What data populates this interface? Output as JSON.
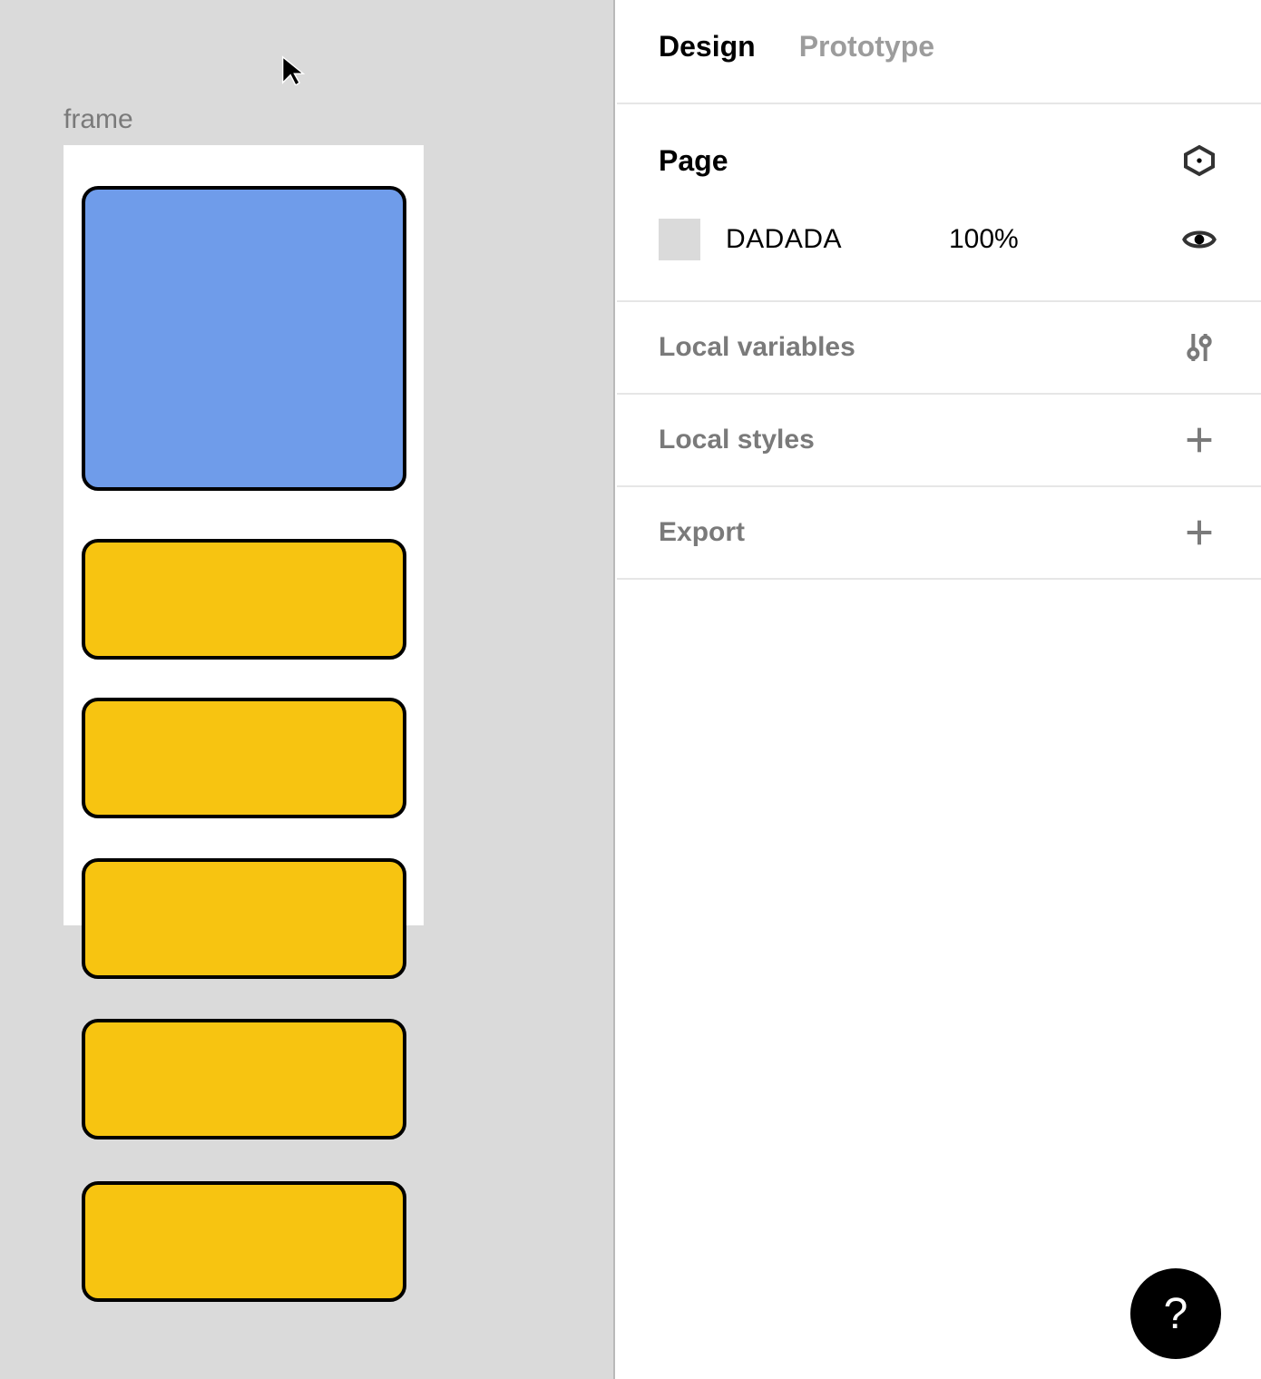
{
  "canvas": {
    "frame_label": "frame",
    "shapes": [
      {
        "kind": "large-blue"
      },
      {
        "kind": "yellow-bar"
      },
      {
        "kind": "yellow-bar"
      },
      {
        "kind": "yellow-bar"
      },
      {
        "kind": "yellow-bar"
      },
      {
        "kind": "yellow-bar"
      }
    ]
  },
  "panel": {
    "tabs": {
      "design": "Design",
      "prototype": "Prototype",
      "active": "design"
    },
    "page": {
      "title": "Page",
      "color_hex": "DADADA",
      "opacity": "100%"
    },
    "local_variables": {
      "title": "Local variables"
    },
    "local_styles": {
      "title": "Local styles"
    },
    "export": {
      "title": "Export"
    }
  },
  "help": {
    "label": "?"
  }
}
